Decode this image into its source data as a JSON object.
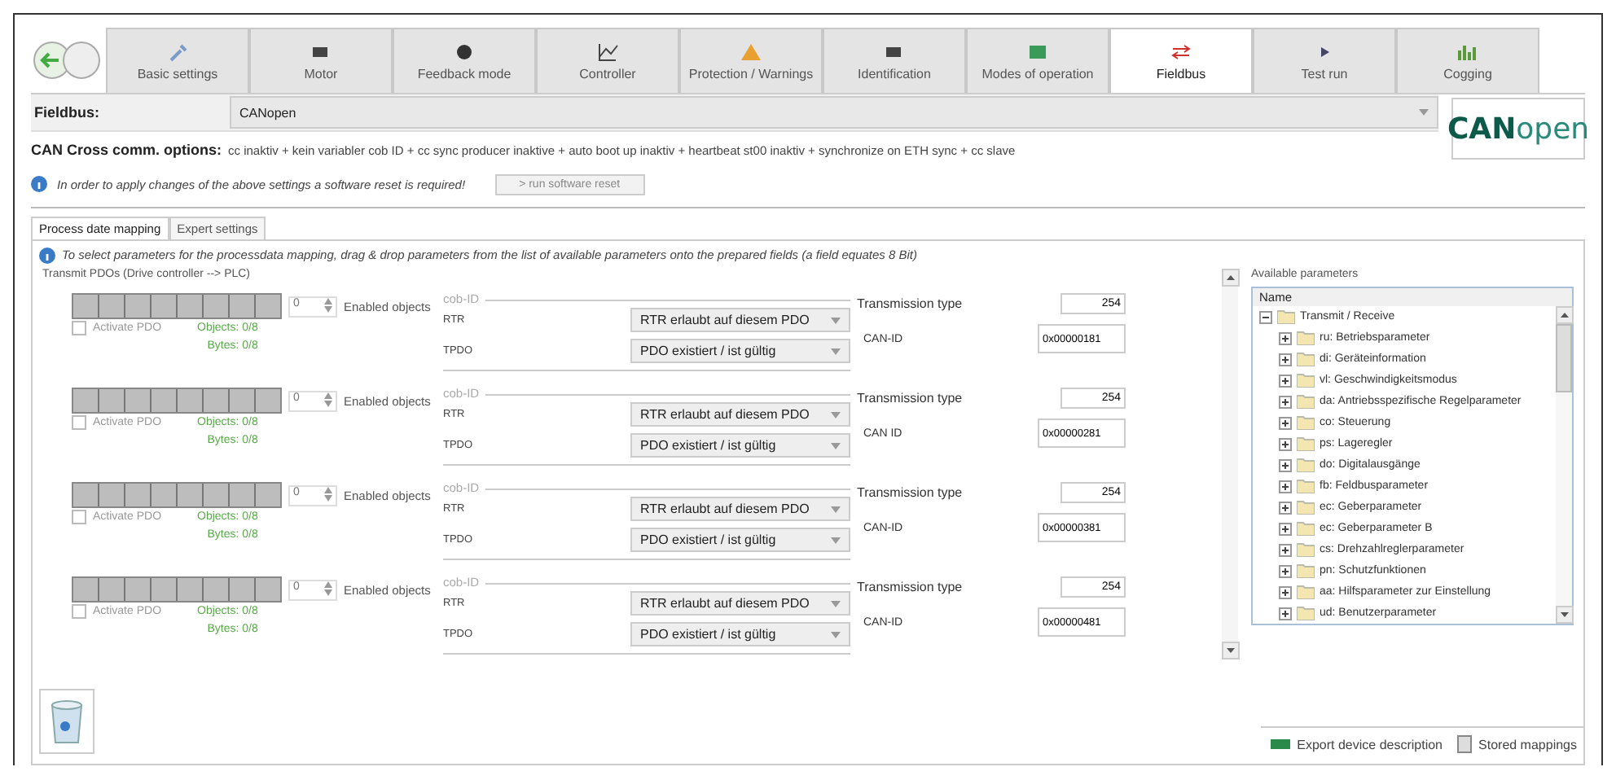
{
  "tabs": [
    {
      "label": "Basic settings",
      "selected": false
    },
    {
      "label": "Motor",
      "selected": false
    },
    {
      "label": "Feedback mode",
      "selected": false
    },
    {
      "label": "Controller",
      "selected": false
    },
    {
      "label": "Protection / Warnings",
      "selected": false
    },
    {
      "label": "Identification",
      "selected": false
    },
    {
      "label": "Modes of operation",
      "selected": false
    },
    {
      "label": "Fieldbus",
      "selected": true
    },
    {
      "label": "Test run",
      "selected": false
    },
    {
      "label": "Cogging",
      "selected": false
    }
  ],
  "fieldbus": {
    "label": "Fieldbus:",
    "value": "CANopen"
  },
  "logo": "**CAN**open",
  "comm_options": {
    "label": "CAN Cross comm. options:",
    "value": "cc inaktiv + kein variabler cob ID + cc sync producer inaktive + auto boot up inaktiv + heartbeat st00 inaktiv + synchronize on ETH sync + cc slave"
  },
  "reset_notice": {
    "text": "In order to apply changes of the above settings a software reset is required!",
    "button": "> run software reset"
  },
  "sub_tabs": [
    {
      "label": "Process date mapping",
      "selected": true
    },
    {
      "label": "Expert settings",
      "selected": false
    }
  ],
  "mapping_hint": "To select parameters for the processdata mapping, drag & drop parameters from the list of available parameters onto the prepared fields (a field equates 8 Bit)",
  "group_title": "Transmit PDOs (Drive controller --> PLC)",
  "pdos": [
    {
      "count": "0",
      "enabled_label": "Enabled objects",
      "activate_label": "Activate PDO",
      "activated": false,
      "objects": "Objects: 0/8",
      "bytes": "Bytes: 0/8",
      "cob_legend": "cob-ID",
      "rtr_label": "RTR",
      "rtr_value": "RTR erlaubt auf diesem PDO",
      "tpdo_label": "TPDO",
      "tpdo_value": "PDO existiert / ist gültig",
      "transmission_label": "Transmission type",
      "transmission_value": "254",
      "can_id_label": "CAN-ID",
      "can_id_value": "0x00000181"
    },
    {
      "count": "0",
      "enabled_label": "Enabled objects",
      "activate_label": "Activate PDO",
      "activated": false,
      "objects": "Objects: 0/8",
      "bytes": "Bytes: 0/8",
      "cob_legend": "cob-ID",
      "rtr_label": "RTR",
      "rtr_value": "RTR erlaubt auf diesem PDO",
      "tpdo_label": "TPDO",
      "tpdo_value": "PDO existiert / ist gültig",
      "transmission_label": "Transmission type",
      "transmission_value": "254",
      "can_id_label": "CAN ID",
      "can_id_value": "0x00000281"
    },
    {
      "count": "0",
      "enabled_label": "Enabled objects",
      "activate_label": "Activate PDO",
      "activated": false,
      "objects": "Objects: 0/8",
      "bytes": "Bytes: 0/8",
      "cob_legend": "cob-ID",
      "rtr_label": "RTR",
      "rtr_value": "RTR erlaubt auf diesem PDO",
      "tpdo_label": "TPDO",
      "tpdo_value": "PDO existiert / ist gültig",
      "transmission_label": "Transmission type",
      "transmission_value": "254",
      "can_id_label": "CAN-ID",
      "can_id_value": "0x00000381"
    },
    {
      "count": "0",
      "enabled_label": "Enabled objects",
      "activate_label": "Activate PDO",
      "activated": false,
      "objects": "Objects: 0/8",
      "bytes": "Bytes: 0/8",
      "cob_legend": "cob-ID",
      "rtr_label": "RTR",
      "rtr_value": "RTR erlaubt auf diesem PDO",
      "tpdo_label": "TPDO",
      "tpdo_value": "PDO existiert / ist gültig",
      "transmission_label": "Transmission type",
      "transmission_value": "254",
      "can_id_label": "CAN-ID",
      "can_id_value": "0x00000481"
    }
  ],
  "parameters": {
    "title": "Available parameters",
    "column": "Name",
    "tree": [
      {
        "label": "Transmit / Receive",
        "expanded": true,
        "children": [
          {
            "label": "ru: Betriebsparameter",
            "expanded": false
          },
          {
            "label": "di: Geräteinformation",
            "expanded": false
          },
          {
            "label": "vl: Geschwindigkeitsmodus",
            "expanded": false
          },
          {
            "label": "da: Antriebsspezifische Regelparameter",
            "expanded": false
          },
          {
            "label": "co: Steuerung",
            "expanded": false
          },
          {
            "label": "ps: Lageregler",
            "expanded": false
          },
          {
            "label": "do: Digitalausgänge",
            "expanded": false
          },
          {
            "label": "fb: Feldbusparameter",
            "expanded": false
          },
          {
            "label": "ec: Geberparameter",
            "expanded": false
          },
          {
            "label": "ec: Geberparameter B",
            "expanded": false
          },
          {
            "label": "cs: Drehzahlreglerparameter",
            "expanded": false
          },
          {
            "label": "pn: Schutzfunktionen",
            "expanded": false
          },
          {
            "label": "aa: Hilfsparameter zur Einstellung",
            "expanded": false
          },
          {
            "label": "ud: Benutzerparameter",
            "expanded": false
          }
        ]
      }
    ]
  },
  "footer_links": [
    {
      "label": "Export device description"
    },
    {
      "label": "Stored mappings"
    }
  ]
}
